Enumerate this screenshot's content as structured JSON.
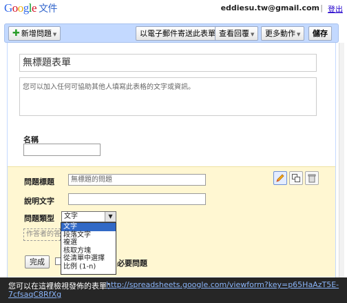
{
  "header": {
    "logo_letters": [
      "G",
      "o",
      "o",
      "g",
      "l",
      "e"
    ],
    "product": "文件",
    "user_email": "eddiesu.tw@gmail.com",
    "separator": "|",
    "signout": "登出"
  },
  "toolbar": {
    "add_question": "新增問題",
    "email_form": "以電子郵件寄送此表單",
    "view_responses": "查看回覆",
    "more_actions": "更多動作",
    "save": "儲存"
  },
  "form": {
    "title": "無標題表單",
    "description_placeholder": "您可以加入任何可協助其他人填寫此表格的文字或資訊。",
    "name_label": "名稱"
  },
  "question_editor": {
    "title_label": "問題標題",
    "title_value": "無標題的問題",
    "help_label": "說明文字",
    "help_value": "",
    "type_label": "問題類型",
    "type_selected": "文字",
    "type_options": [
      "文字",
      "段落文字",
      "複選",
      "核取方塊",
      "從清單中選擇",
      "比例 (1-n)"
    ],
    "respondent_placeholder": "作答者的答",
    "done": "完成",
    "required_label": "必要問題"
  },
  "footer": {
    "message": "您可以在這裡檢視發佈的表單：",
    "url_line1": "http://spreadsheets.google.com/viewform?key=p65HaAzT5E-",
    "url_line2": "7cfsaqC8RfXg"
  }
}
